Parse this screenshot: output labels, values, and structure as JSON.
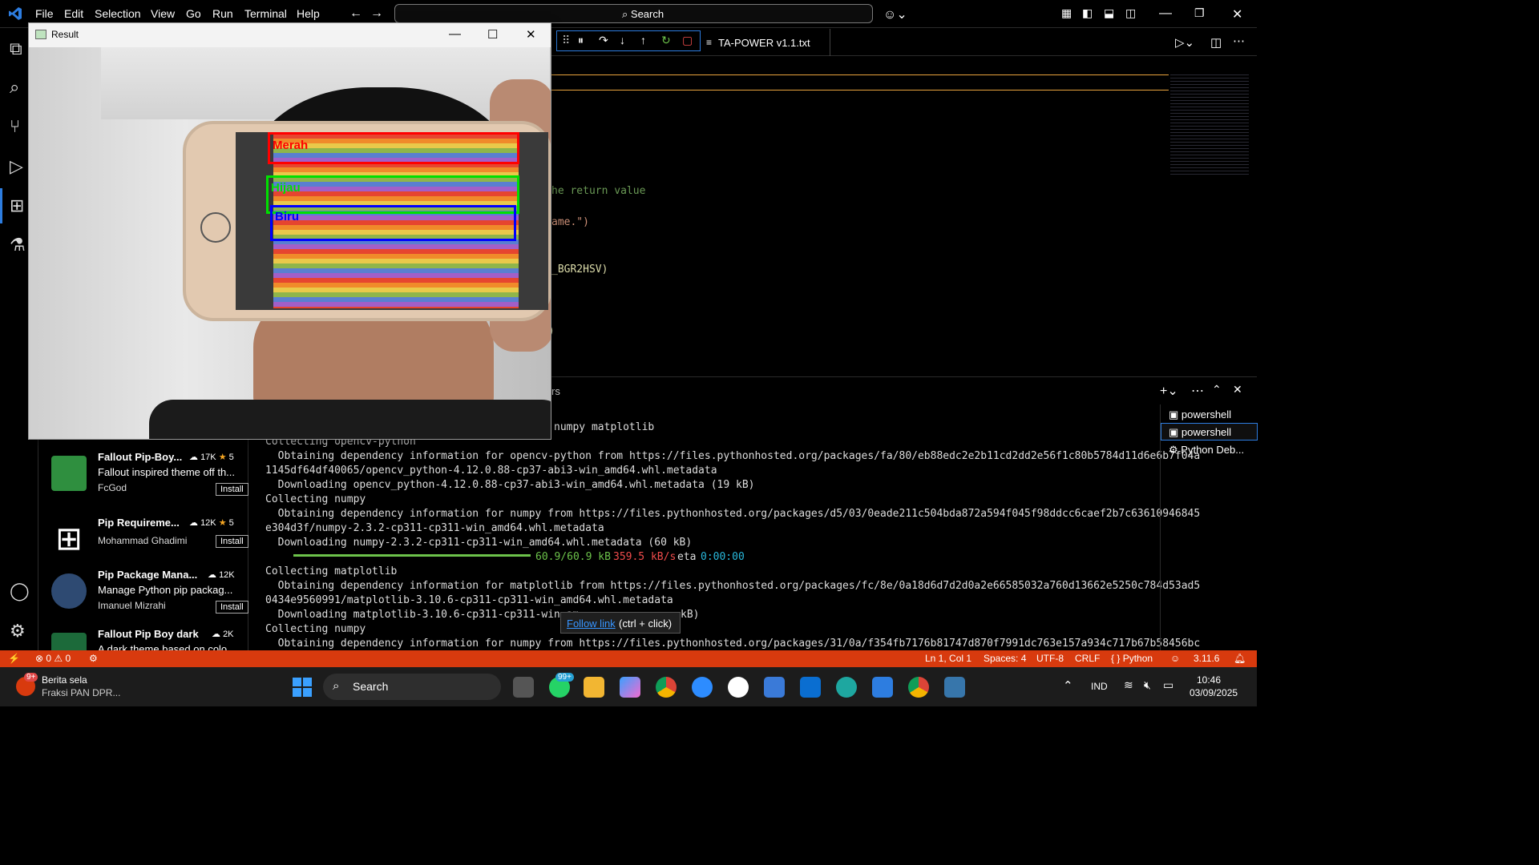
{
  "menu": {
    "items": [
      "File",
      "Edit",
      "Selection",
      "View",
      "Go",
      "Run",
      "Terminal",
      "Help"
    ]
  },
  "search": {
    "label": "Search"
  },
  "editor_tab": {
    "label": "TA-POWER v1.1.txt"
  },
  "code_fragments": [
    "he return value",
    "ame.\")",
    "_BGR2HSV)",
    ")"
  ],
  "panel_tab": {
    "label": "rs"
  },
  "terminal": {
    "lines": [
      {
        "text": "numpy matplotlib",
        "indent": false,
        "offset": 360
      },
      {
        "text": "Collecting opencv-python",
        "indent": false
      },
      {
        "text": "  Obtaining dependency information for opencv-python from https://files.pythonhosted.org/packages/fa/80/eb88edc2e2b11cd2dd2e56f1c80b5784d11d6e6b7f04a",
        "indent": false
      },
      {
        "text": "1145df64df40065/opencv_python-4.12.0.88-cp37-abi3-win_amd64.whl.metadata",
        "indent": false
      },
      {
        "text": "  Downloading opencv_python-4.12.0.88-cp37-abi3-win_amd64.whl.metadata (19 kB)",
        "indent": false
      },
      {
        "text": "Collecting numpy",
        "indent": false
      },
      {
        "text": "  Obtaining dependency information for numpy from https://files.pythonhosted.org/packages/d5/03/0eade211c504bda872a594f045f98ddcc6caef2b7c63610946845",
        "indent": false
      },
      {
        "text": "e304d3f/numpy-2.3.2-cp311-cp311-win_amd64.whl.metadata",
        "indent": false
      },
      {
        "text": "  Downloading numpy-2.3.2-cp311-cp311-win_amd64.whl.metadata (60 kB)",
        "indent": false
      },
      {
        "text": "",
        "indent": false
      },
      {
        "text": "Collecting matplotlib",
        "indent": false
      },
      {
        "text": "  Obtaining dependency information for matplotlib from https://files.pythonhosted.org/packages/fc/8e/0a18d6d7d2d0a2e66585032a760d13662e5250c784d53ad5",
        "indent": false
      },
      {
        "text": "0434e9560991/matplotlib-3.10.6-cp311-cp311-win_amd64.whl.metadata",
        "indent": false
      },
      {
        "text": "  Downloading matplotlib-3.10.6-cp311-cp311-win_am",
        "indent": false
      },
      {
        "text": "Collecting numpy",
        "indent": false
      },
      {
        "text": "  Obtaining dependency information for numpy from https://files.pythonhosted.org/packages/31/0a/f354fb7176b81747d870f7991dc763e157a934c717b67b58456bc",
        "indent": false
      }
    ],
    "progress": {
      "size": "60.9/60.9 kB",
      "speed": "359.5 kB/s",
      "eta_label": "eta",
      "eta": "0:00:00",
      "fraction": 1.0
    },
    "tail_kb": "kB)"
  },
  "tooltip": {
    "link": "Follow link",
    "hint": " (ctrl + click)"
  },
  "terminals": [
    "powershell",
    "powershell",
    "Python Deb..."
  ],
  "extensions": [
    {
      "name": "Fallout Pip-Boy...",
      "downloads": "17K",
      "rating": "5",
      "desc": "Fallout inspired theme off th...",
      "publisher": "FcGod",
      "install": "Install",
      "color": "#2f8f3f"
    },
    {
      "name": "Pip Requireme...",
      "downloads": "12K",
      "rating": "5",
      "desc": "",
      "publisher": "Mohammad Ghadimi",
      "install": "Install",
      "color": "#000000"
    },
    {
      "name": "Pip Package Mana...",
      "downloads": "12K",
      "rating": "",
      "desc": "Manage Python pip packag...",
      "publisher": "Imanuel Mizrahi",
      "install": "Install",
      "color": "#2e4a72"
    },
    {
      "name": "Fallout Pip Boy dark",
      "downloads": "2K",
      "rating": "",
      "desc": "A dark theme based on colo...",
      "publisher": "",
      "install": "",
      "color": "#1c6a3a"
    }
  ],
  "result_window": {
    "title": "Result",
    "labels": [
      {
        "text": "Merah",
        "color": "#ff0000"
      },
      {
        "text": "Hijau",
        "color": "#00e000"
      },
      {
        "text": "Biru",
        "color": "#0000ff"
      }
    ]
  },
  "statusbar": {
    "errors": "0",
    "warnings": "0",
    "position": "Ln 1, Col 1",
    "spaces": "Spaces: 4",
    "encoding": "UTF-8",
    "eol": "CRLF",
    "language": "Python",
    "version": "3.11.6"
  },
  "taskbar": {
    "news_badge": "9+",
    "news_title": "Berita sela",
    "news_sub": "Fraksi PAN DPR...",
    "search": "Search",
    "whatsapp_badge": "99+",
    "lang": "IND",
    "time": "10:46",
    "date": "03/09/2025"
  },
  "colors": {
    "accent": "#2d7de0",
    "status": "#d83a0e",
    "code_green": "#6a9955",
    "code_orange": "#ce9178",
    "code_yellow": "#dcdcaa",
    "term_green": "#6cc24a",
    "term_red": "#f14c4c",
    "term_cyan": "#29b8db"
  }
}
